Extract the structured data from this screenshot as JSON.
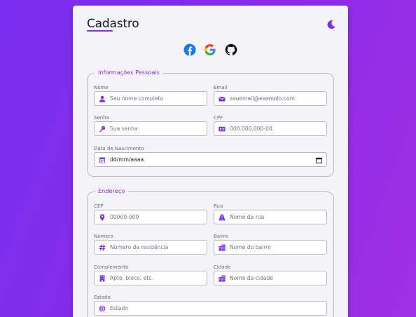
{
  "form": {
    "title": "Cadastro",
    "colors": {
      "accent": "#7b2ff0",
      "legend": "#8c2fd6",
      "background_start": "#7b2ff0",
      "background_end": "#a12fe6"
    },
    "theme_toggle_icon": "moon-icon",
    "social": [
      {
        "name": "facebook",
        "icon": "facebook-icon",
        "color": "#1877f2"
      },
      {
        "name": "google",
        "icon": "google-icon"
      },
      {
        "name": "github",
        "icon": "github-icon",
        "color": "#111111"
      }
    ]
  },
  "personal": {
    "legend": "Informações Pessoais",
    "nome": {
      "label": "Nome",
      "placeholder": "Seu nome completo",
      "icon": "user-icon"
    },
    "email": {
      "label": "Email",
      "placeholder": "seuemail@exemplo.com",
      "icon": "envelope-icon"
    },
    "senha": {
      "label": "Senha",
      "placeholder": "Sua senha",
      "icon": "key-icon"
    },
    "cpf": {
      "label": "CPF",
      "placeholder": "000.000.000-00",
      "icon": "id-card-icon"
    },
    "nascimento": {
      "label": "Data de Nascimento",
      "value": "dd/mm/aaaa",
      "icon": "calendar-icon"
    }
  },
  "address": {
    "legend": "Endereço",
    "cep": {
      "label": "CEP",
      "placeholder": "00000-000",
      "icon": "map-pin-icon"
    },
    "rua": {
      "label": "Rua",
      "placeholder": "Nome da rua",
      "icon": "road-icon"
    },
    "numero": {
      "label": "Número",
      "placeholder": "Número da residência",
      "icon": "hashtag-icon"
    },
    "bairro": {
      "label": "Bairro",
      "placeholder": "Nome do bairro",
      "icon": "city-icon"
    },
    "complemento": {
      "label": "Complemento",
      "placeholder": "Apto, bloco, etc.",
      "icon": "building-icon"
    },
    "cidade": {
      "label": "Cidade",
      "placeholder": "Nome da cidade",
      "icon": "city-icon"
    },
    "estado": {
      "label": "Estado",
      "placeholder": "Estado",
      "icon": "globe-icon"
    }
  }
}
